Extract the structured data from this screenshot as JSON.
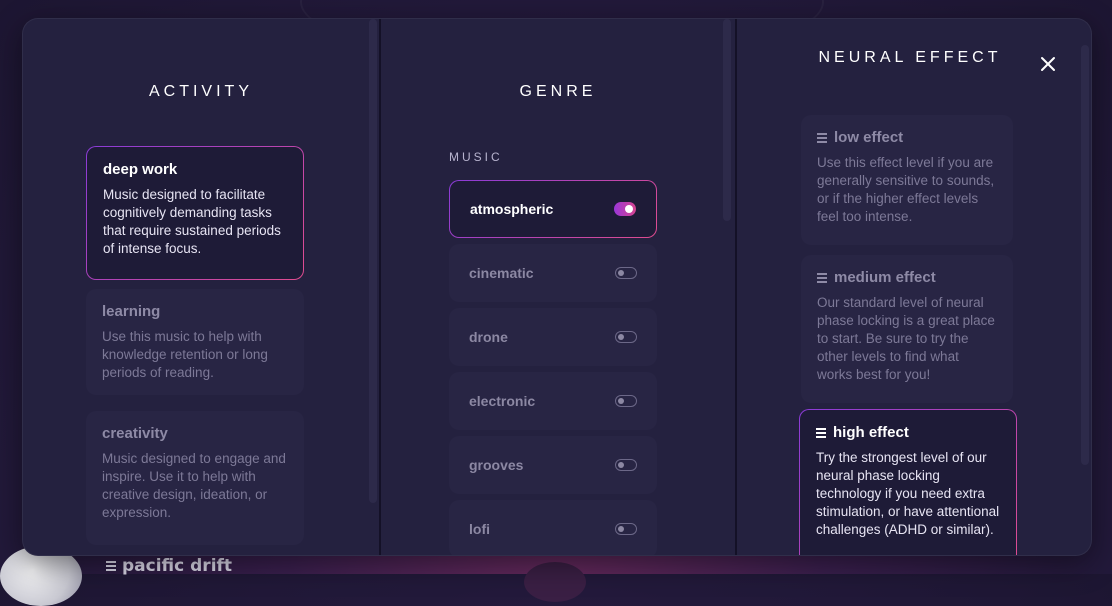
{
  "background": {
    "now_playing_title": "pacific drift"
  },
  "activity": {
    "title": "ACTIVITY",
    "items": [
      {
        "name": "deep work",
        "desc": "Music designed to facilitate cognitively demanding tasks that require sustained periods of intense focus.",
        "selected": true
      },
      {
        "name": "learning",
        "desc": "Use this music to help with knowledge retention or long periods of reading.",
        "selected": false
      },
      {
        "name": "creativity",
        "desc": "Music designed to engage and inspire. Use it to help with creative design, ideation, or expression.",
        "selected": false
      }
    ]
  },
  "genre": {
    "title": "GENRE",
    "section": "MUSIC",
    "items": [
      {
        "name": "atmospheric",
        "on": true
      },
      {
        "name": "cinematic",
        "on": false
      },
      {
        "name": "drone",
        "on": false
      },
      {
        "name": "electronic",
        "on": false
      },
      {
        "name": "grooves",
        "on": false
      },
      {
        "name": "lofi",
        "on": false
      }
    ]
  },
  "neural": {
    "title": "NEURAL EFFECT",
    "items": [
      {
        "name": "low effect",
        "desc": "Use this effect level if you are generally sensitive to sounds, or if the higher effect levels feel too intense.",
        "selected": false
      },
      {
        "name": "medium effect",
        "desc": "Our standard level of neural phase locking is a great place to start. Be sure to try the other levels to find what works best for you!",
        "selected": false
      },
      {
        "name": "high effect",
        "desc": "Try the strongest level of our neural phase locking technology if you need extra stimulation, or have attentional challenges (ADHD or similar).",
        "selected": true
      }
    ]
  },
  "colors": {
    "accent_start": "#8a3bd8",
    "accent_end": "#e04c8f",
    "panel": "#24213f"
  },
  "icons": {
    "close": "close-icon",
    "effect": "effect-level-icon"
  }
}
